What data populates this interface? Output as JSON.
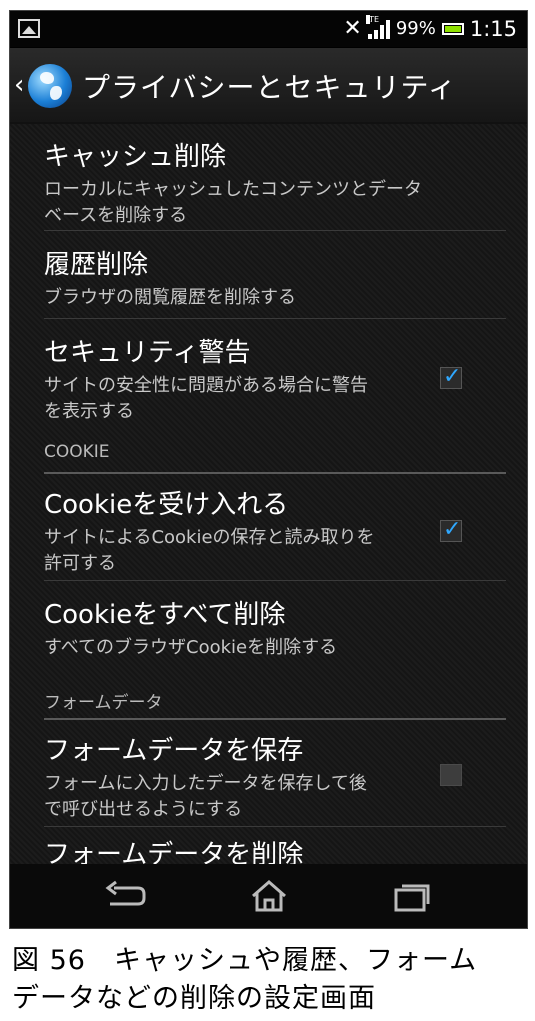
{
  "status_bar": {
    "icons": [
      "image-icon",
      "no-vibrate-icon",
      "lte-signal-icon",
      "battery-icon"
    ],
    "lte_label": "LTE",
    "battery": "99%",
    "time": "1:15"
  },
  "action_bar": {
    "title": "プライバシーとセキュリティ",
    "icon": "globe-icon"
  },
  "items": [
    {
      "title": "キャッシュ削除",
      "summary": [
        "ローカルにキャッシュしたコンテンツとデータ",
        "ベースを削除する"
      ]
    },
    {
      "title": "履歴削除",
      "summary": [
        "ブラウザの閲覧履歴を削除する"
      ]
    },
    {
      "title": "セキュリティ警告",
      "summary": [
        "サイトの安全性に問題がある場合に警告",
        "を表示する"
      ],
      "checked": true
    },
    {
      "title": "Cookieを受け入れる",
      "summary": [
        "サイトによるCookieの保存と読み取りを",
        "許可する"
      ],
      "checked": true
    },
    {
      "title": "Cookieをすべて削除",
      "summary": [
        "すべてのブラウザCookieを削除する"
      ]
    },
    {
      "title": "フォームデータを保存",
      "summary": [
        "フォームに入力したデータを保存して後",
        "で呼び出せるようにする"
      ],
      "checked": false
    },
    {
      "title": "フォームデータを削除"
    }
  ],
  "sections": {
    "cookie": "COOKIE",
    "form_data": "フォームデータ"
  },
  "nav_bar": {
    "buttons": [
      "back-icon",
      "home-icon",
      "recent-apps-icon"
    ]
  },
  "caption": {
    "line1": "図 56　キャッシュや履歴、フォーム",
    "line2": "データなどの削除の設定画面"
  }
}
